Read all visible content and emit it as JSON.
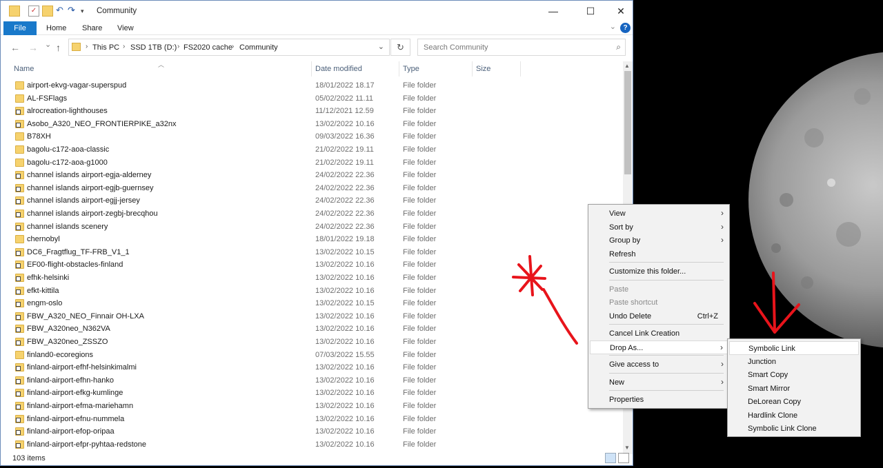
{
  "window": {
    "title": "Community",
    "minimize": "—",
    "maximize": "☐",
    "close": "✕"
  },
  "ribbon": {
    "tabs": [
      "File",
      "Home",
      "Share",
      "View"
    ],
    "help": "?"
  },
  "nav": {
    "back": "←",
    "forward": "→",
    "recent": "⌄",
    "up": "↑",
    "crumbs": [
      "This PC",
      "SSD 1TB (D:)",
      "FS2020 cache",
      "Community"
    ],
    "search_placeholder": "Search Community"
  },
  "columns": [
    "Name",
    "Date modified",
    "Type",
    "Size"
  ],
  "files": [
    {
      "name": "airport-ekvg-vagar-superspud",
      "date": "18/01/2022 18.17",
      "type": "File folder",
      "link": false
    },
    {
      "name": "AL-FSFlags",
      "date": "05/02/2022 11.11",
      "type": "File folder",
      "link": false
    },
    {
      "name": "alrocreation-lighthouses",
      "date": "11/12/2021 12.59",
      "type": "File folder",
      "link": true
    },
    {
      "name": "Asobo_A320_NEO_FRONTIERPIKE_a32nx",
      "date": "13/02/2022 10.16",
      "type": "File folder",
      "link": true
    },
    {
      "name": "B78XH",
      "date": "09/03/2022 16.36",
      "type": "File folder",
      "link": false
    },
    {
      "name": "bagolu-c172-aoa-classic",
      "date": "21/02/2022 19.11",
      "type": "File folder",
      "link": false
    },
    {
      "name": "bagolu-c172-aoa-g1000",
      "date": "21/02/2022 19.11",
      "type": "File folder",
      "link": false
    },
    {
      "name": "channel islands airport-egja-alderney",
      "date": "24/02/2022 22.36",
      "type": "File folder",
      "link": true
    },
    {
      "name": "channel islands airport-egjb-guernsey",
      "date": "24/02/2022 22.36",
      "type": "File folder",
      "link": true
    },
    {
      "name": "channel islands airport-egjj-jersey",
      "date": "24/02/2022 22.36",
      "type": "File folder",
      "link": true
    },
    {
      "name": "channel islands airport-zegbj-brecqhou",
      "date": "24/02/2022 22.36",
      "type": "File folder",
      "link": true
    },
    {
      "name": "channel islands scenery",
      "date": "24/02/2022 22.36",
      "type": "File folder",
      "link": true
    },
    {
      "name": "chernobyl",
      "date": "18/01/2022 19.18",
      "type": "File folder",
      "link": false
    },
    {
      "name": "DC6_Fragtflug_TF-FRB_V1_1",
      "date": "13/02/2022 10.15",
      "type": "File folder",
      "link": true
    },
    {
      "name": "EF00-flight-obstacles-finland",
      "date": "13/02/2022 10.16",
      "type": "File folder",
      "link": true
    },
    {
      "name": "efhk-helsinki",
      "date": "13/02/2022 10.16",
      "type": "File folder",
      "link": true
    },
    {
      "name": "efkt-kittila",
      "date": "13/02/2022 10.16",
      "type": "File folder",
      "link": true
    },
    {
      "name": "engm-oslo",
      "date": "13/02/2022 10.15",
      "type": "File folder",
      "link": true
    },
    {
      "name": "FBW_A320_NEO_Finnair OH-LXA",
      "date": "13/02/2022 10.16",
      "type": "File folder",
      "link": true
    },
    {
      "name": "FBW_A320neo_N362VA",
      "date": "13/02/2022 10.16",
      "type": "File folder",
      "link": true
    },
    {
      "name": "FBW_A320neo_ZSSZO",
      "date": "13/02/2022 10.16",
      "type": "File folder",
      "link": true
    },
    {
      "name": "finland0-ecoregions",
      "date": "07/03/2022 15.55",
      "type": "File folder",
      "link": false
    },
    {
      "name": "finland-airport-efhf-helsinkimalmi",
      "date": "13/02/2022 10.16",
      "type": "File folder",
      "link": true
    },
    {
      "name": "finland-airport-efhn-hanko",
      "date": "13/02/2022 10.16",
      "type": "File folder",
      "link": true
    },
    {
      "name": "finland-airport-efkg-kumlinge",
      "date": "13/02/2022 10.16",
      "type": "File folder",
      "link": true
    },
    {
      "name": "finland-airport-efma-mariehamn",
      "date": "13/02/2022 10.16",
      "type": "File folder",
      "link": true
    },
    {
      "name": "finland-airport-efnu-nummela",
      "date": "13/02/2022 10.16",
      "type": "File folder",
      "link": true
    },
    {
      "name": "finland-airport-efop-oripaa",
      "date": "13/02/2022 10.16",
      "type": "File folder",
      "link": true
    },
    {
      "name": "finland-airport-efpr-pyhtaa-redstone",
      "date": "13/02/2022 10.16",
      "type": "File folder",
      "link": true
    }
  ],
  "status": {
    "count": "103 items"
  },
  "context_menu": [
    {
      "label": "View",
      "submenu": true
    },
    {
      "label": "Sort by",
      "submenu": true
    },
    {
      "label": "Group by",
      "submenu": true
    },
    {
      "label": "Refresh"
    },
    {
      "sep": true
    },
    {
      "label": "Customize this folder..."
    },
    {
      "sep": true
    },
    {
      "label": "Paste",
      "disabled": true
    },
    {
      "label": "Paste shortcut",
      "disabled": true
    },
    {
      "label": "Undo Delete",
      "shortcut": "Ctrl+Z"
    },
    {
      "sep": true
    },
    {
      "label": "Cancel Link Creation"
    },
    {
      "label": "Drop As...",
      "submenu": true,
      "highlighted": true
    },
    {
      "sep": true
    },
    {
      "label": "Give access to",
      "submenu": true
    },
    {
      "sep": true
    },
    {
      "label": "New",
      "submenu": true
    },
    {
      "sep": true
    },
    {
      "label": "Properties"
    }
  ],
  "submenu": [
    {
      "label": "Symbolic Link",
      "highlighted": true
    },
    {
      "label": "Junction"
    },
    {
      "label": "Smart Copy"
    },
    {
      "label": "Smart Mirror"
    },
    {
      "label": "DeLorean Copy"
    },
    {
      "label": "Hardlink Clone"
    },
    {
      "label": "Symbolic Link Clone"
    }
  ],
  "colors": {
    "accent": "#1979ca",
    "annotation": "#e8141b",
    "folder": "#f6d26e"
  }
}
